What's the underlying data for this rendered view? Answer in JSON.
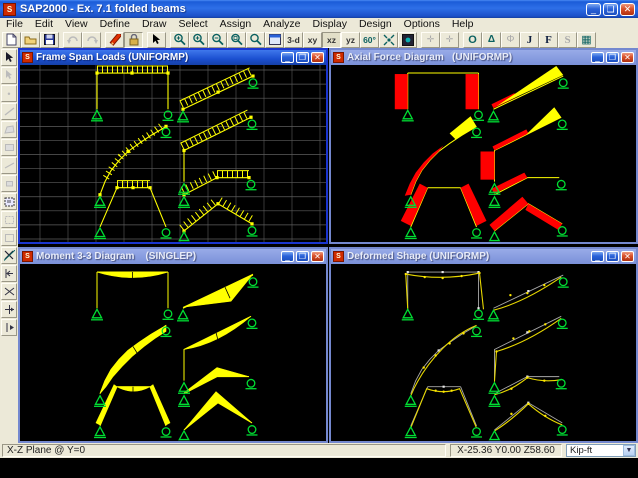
{
  "window": {
    "title": "SAP2000 - Ex. 7.1 folded beams",
    "app_icon_label": "S"
  },
  "menu": {
    "items": [
      "File",
      "Edit",
      "View",
      "Define",
      "Draw",
      "Select",
      "Assign",
      "Analyze",
      "Display",
      "Design",
      "Options",
      "Help"
    ]
  },
  "toolbar": {
    "view_buttons": [
      "3-d",
      "xy",
      "xz",
      "yz"
    ],
    "perspective_label": "60°",
    "letter_buttons": [
      "O",
      "Δ",
      "Φ",
      "J",
      "F",
      "S"
    ],
    "grid_button": "▦"
  },
  "viewports": [
    {
      "title": "Frame Span Loads (UNIFORMP)",
      "state": "active"
    },
    {
      "title": "Axial Force Diagram   (UNIFORMP)",
      "state": "inactive"
    },
    {
      "title": "Moment 3-3 Diagram    (SINGLEP)",
      "state": "inactive"
    },
    {
      "title": "Deformed Shape (UNIFORMP)",
      "state": "inactive"
    }
  ],
  "window_controls": {
    "minimize": "_",
    "restore": "❏",
    "close": "✕"
  },
  "statusbar": {
    "plane": "X-Z Plane @ Y=0",
    "coords": "X-25.36 Y0.00 Z58.60",
    "units": "Kip-ft",
    "units_dropdown_arrow": "▼"
  },
  "colors": {
    "member_yellow": "#ffff00",
    "axial_compression_red": "#ff0000",
    "support_green": "#00dd33",
    "grid_gray": "#5b5b5b",
    "undeformed_gray": "#b0b0b0",
    "titlebar_active_blue": "#1b4fd0",
    "titlebar_inactive_blue": "#8398dc",
    "chrome_beige": "#ece9d8"
  }
}
